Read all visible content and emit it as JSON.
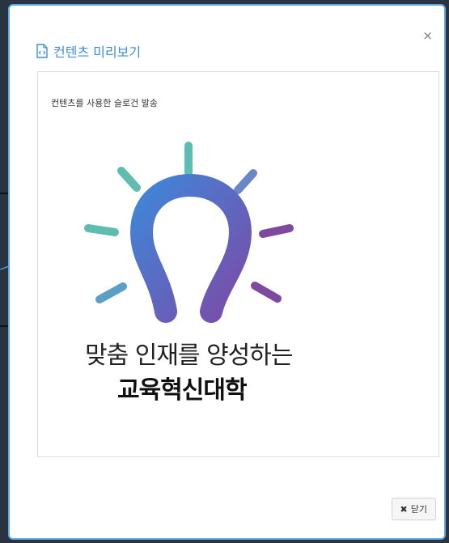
{
  "modal": {
    "title": "컨텐츠 미리보기",
    "close_glyph": "×",
    "close_button_label": "닫기",
    "close_button_glyph": "✖"
  },
  "content": {
    "caption": "컨텐츠를 사용한 슬로건 발송",
    "slogan_line1": "맞춤 인재를 양성하는",
    "slogan_line2": "교육혁신대학"
  },
  "colors": {
    "accent": "#3d8fd8",
    "border": "#5aa9e6",
    "ray_teal": "#5dbdb0",
    "ray_blue": "#6a86c6",
    "ray_purple": "#7d4aa0",
    "bulb_start": "#3f86d8",
    "bulb_end": "#7a4ca8"
  },
  "icons": {
    "title_icon": "document-code-icon",
    "close_icon": "close-icon",
    "button_icon": "times-icon"
  }
}
